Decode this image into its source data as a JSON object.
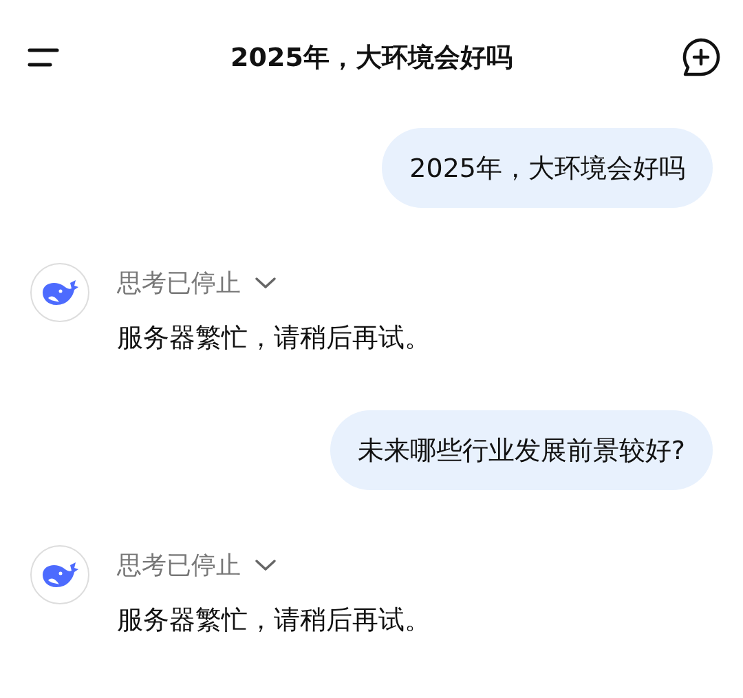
{
  "header": {
    "title": "2025年，大环境会好吗"
  },
  "messages": [
    {
      "kind": "user",
      "text": "2025年，大环境会好吗"
    },
    {
      "kind": "assistant",
      "thinking_label": "思考已停止",
      "expanded": false,
      "text": "服务器繁忙，请稍后再试。"
    },
    {
      "kind": "user",
      "text": "未来哪些行业发展前景较好?"
    },
    {
      "kind": "assistant",
      "thinking_label": "思考已停止",
      "expanded": false,
      "text": "服务器繁忙，请稍后再试。"
    }
  ]
}
